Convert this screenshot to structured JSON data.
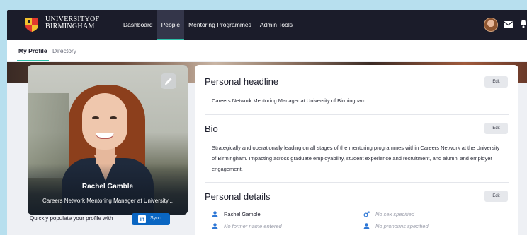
{
  "header": {
    "logo_line1": "UNIVERSITYOF",
    "logo_line2": "BIRMINGHAM",
    "nav": [
      {
        "label": "Dashboard"
      },
      {
        "label": "People"
      },
      {
        "label": "Mentoring Programmes"
      },
      {
        "label": "Admin Tools"
      }
    ]
  },
  "subnav": {
    "tabs": [
      {
        "label": "My Profile"
      },
      {
        "label": "Directory"
      }
    ]
  },
  "profile_card": {
    "name": "Rachel Gamble",
    "role": "Careers Network Mentoring Manager at University..."
  },
  "linkedin": {
    "prompt": "Quickly populate your profile with",
    "logo_text": "in",
    "sync_label": "Sync"
  },
  "sections": {
    "headline": {
      "title": "Personal headline",
      "edit_label": "Edit",
      "text": "Careers Network Mentoring Manager at University of Birmingham"
    },
    "bio": {
      "title": "Bio",
      "edit_label": "Edit",
      "text": "Strategically and operationally leading on all stages of the mentoring programmes within Careers Network at the University of Birmingham. Impacting across graduate employability, student experience and recruitment, and alumni and employer engagement."
    },
    "details": {
      "title": "Personal details",
      "edit_label": "Edit",
      "name": "Rachel Gamble",
      "former_name": "No former name entered",
      "sex": "No sex specified",
      "pronouns": "No pronouns specified"
    }
  },
  "colors": {
    "accent": "#2cbfa8",
    "header_bg": "#1b1c2a",
    "linkedin": "#0a66c2",
    "detail_icon": "#2f78d6"
  }
}
